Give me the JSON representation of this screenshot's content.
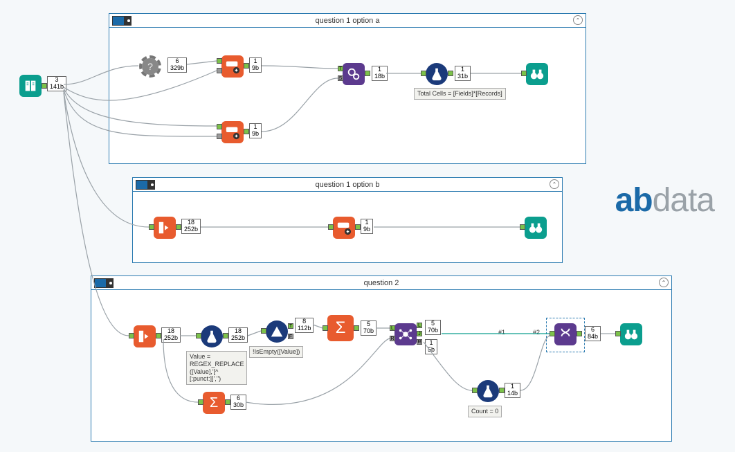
{
  "containers": {
    "c1a": {
      "title": "question 1 option a"
    },
    "c1b": {
      "title": "question 1 option b"
    },
    "c2": {
      "title": "question 2"
    }
  },
  "input_tool": {
    "rows": "3",
    "size": "141b"
  },
  "c1a_nodes": {
    "gear": {
      "rows": "6",
      "size": "329b"
    },
    "append1": {
      "rows": "1",
      "size": "9b"
    },
    "append2": {
      "rows": "1",
      "size": "9b"
    },
    "join": {
      "rows": "1",
      "size": "18b"
    },
    "formula": {
      "rows": "1",
      "size": "31b",
      "expr": "Total Cells = [Fields]*[Records]"
    }
  },
  "c1b_nodes": {
    "transpose": {
      "rows": "18",
      "size": "252b"
    },
    "append": {
      "rows": "1",
      "size": "9b"
    }
  },
  "c2_nodes": {
    "transpose": {
      "rows": "18",
      "size": "252b"
    },
    "formula1": {
      "rows": "18",
      "size": "252b",
      "expr1": "Value =",
      "expr2": "REGEX_REPLACE",
      "expr3": "([Value],'[^",
      "expr4": "[:punct:]]','')"
    },
    "filter": {
      "rows": "8",
      "size": "112b",
      "expr": "!IsEmpty([Value])"
    },
    "summarize1": {
      "rows": "5",
      "size": "70b"
    },
    "summarize2": {
      "rows": "6",
      "size": "30b"
    },
    "joinmulti": {
      "rowsL": "5",
      "sizeL": "70b",
      "rowsR": "1",
      "sizeR": "5b"
    },
    "formula2": {
      "rows": "1",
      "size": "14b",
      "expr": "Count = 0"
    },
    "union": {
      "rows": "6",
      "size": "84b"
    },
    "conn1": "#1",
    "conn2": "#2"
  },
  "logo": {
    "ab": "ab",
    "data": "data"
  }
}
